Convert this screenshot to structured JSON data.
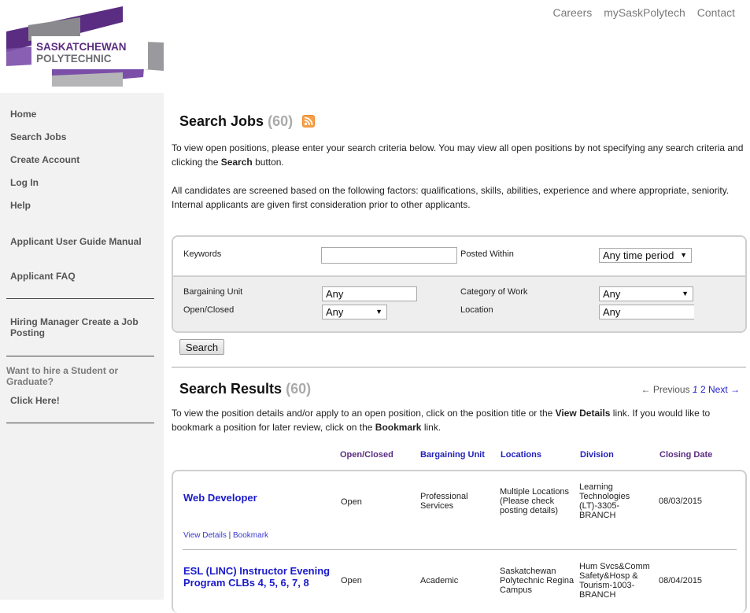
{
  "brand": {
    "line1": "SASKATCHEWAN",
    "line2": "POLYTECHNIC",
    "colors": {
      "purple": "#5a2d82",
      "gray": "#6d6e71"
    }
  },
  "top_nav": [
    "Careers",
    "mySaskPolytech",
    "Contact"
  ],
  "sidebar": {
    "items": [
      {
        "label": "Home"
      },
      {
        "label": "Search Jobs"
      },
      {
        "label": "Create Account"
      },
      {
        "label": "Log In"
      },
      {
        "label": "Help"
      },
      {
        "label": "Applicant User Guide Manual"
      },
      {
        "label": "Applicant FAQ"
      },
      {
        "label": "Hiring Manager Create a Job Posting"
      }
    ],
    "note": "Want to hire a Student or Graduate?",
    "click_here": "Click Here!",
    "rule_text": "______________________________"
  },
  "search_jobs": {
    "title": "Search Jobs",
    "count": "(60)",
    "rss_icon": "rss-feed-icon",
    "intro_1a": "To view open positions, please enter your search criteria below.  You may view all open positions by not specifying any search criteria and clicking the ",
    "intro_1b": "Search",
    "intro_1c": " button.",
    "intro_2": "All candidates are screened based on the following factors: qualifications, skills, abilities, experience and where appropriate, seniority. Internal applicants are given first consideration prior to other applicants."
  },
  "form": {
    "keywords_label": "Keywords",
    "keywords_value": "",
    "posted_within_label": "Posted Within",
    "posted_within_value": "Any time period",
    "bargaining_unit_label": "Bargaining Unit",
    "bargaining_unit_value": "Any",
    "category_label": "Category of Work",
    "category_value": "Any",
    "open_closed_label": "Open/Closed",
    "open_closed_value": "Any",
    "location_label": "Location",
    "location_value": "Any",
    "search_button": "Search",
    "arrow": "▼"
  },
  "results": {
    "title": "Search Results",
    "count": "(60)",
    "pager": {
      "prev": "← Previous",
      "current": "1",
      "page2": "2",
      "next": "Next →"
    },
    "intro_a": "To view the position details and/or apply to an open position, click on the position title or the ",
    "intro_b": "View Details",
    "intro_c": " link.  If you would like to bookmark a position for later review, click on the ",
    "intro_d": "Bookmark",
    "intro_e": " link.",
    "columns": [
      "Open/Closed",
      "Bargaining Unit",
      "Locations",
      "Division",
      "Closing Date"
    ],
    "rows": [
      {
        "title": "Web Developer",
        "status": "Open",
        "bargaining_unit": "Professional Services",
        "location": "Multiple Locations (Please check posting details)",
        "division": "Learning Technologies (LT)-3305-BRANCH",
        "closing_date": "08/03/2015",
        "view_details": "View Details",
        "separator": "|",
        "bookmark": "Bookmark"
      },
      {
        "title": "ESL (LINC) Instructor Evening Program CLBs 4, 5, 6, 7, 8",
        "status": "Open",
        "bargaining_unit": "Academic",
        "location": "Saskatchewan Polytechnic Regina Campus",
        "division": "Hum Svcs&Comm Safety&Hosp & Tourism-1003-BRANCH",
        "closing_date": "08/04/2015"
      }
    ]
  }
}
